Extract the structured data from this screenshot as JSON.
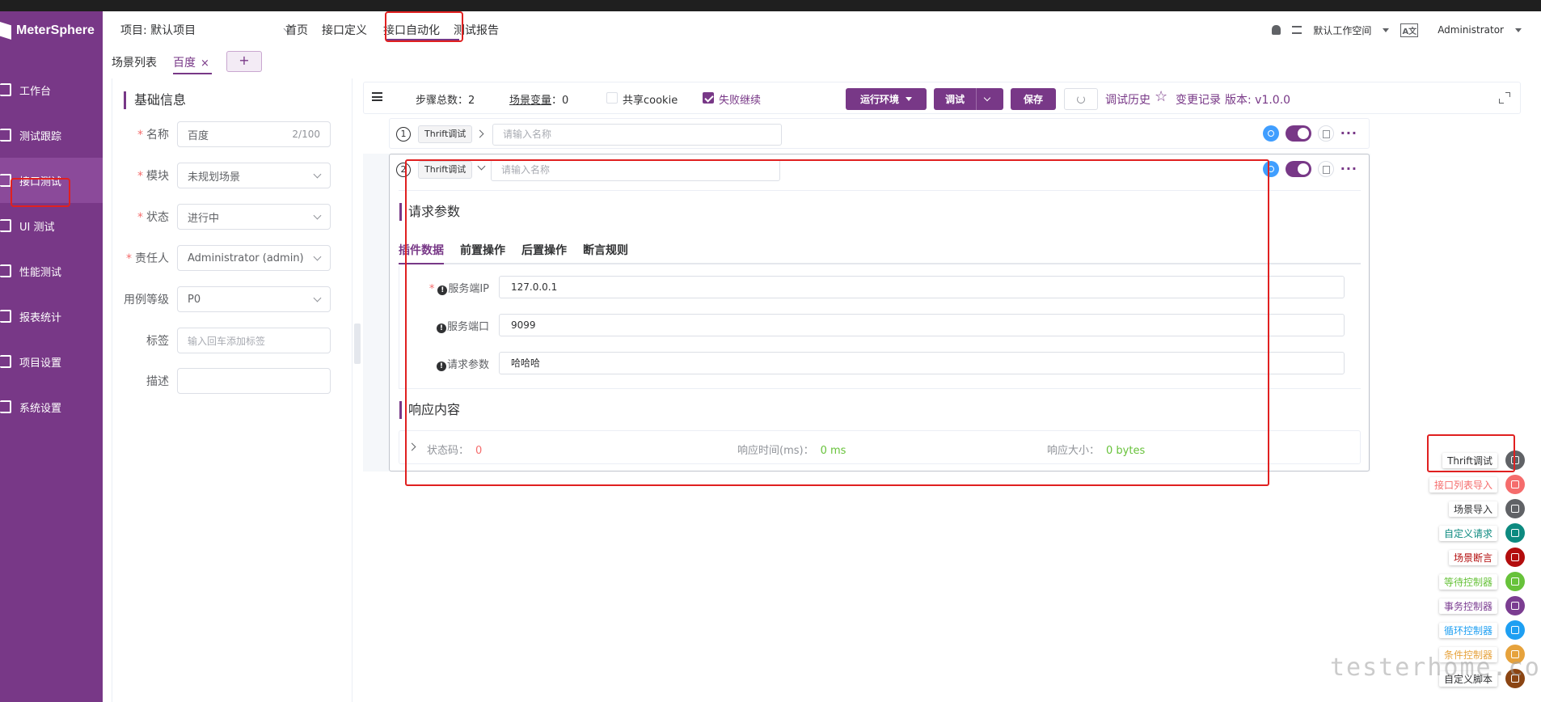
{
  "app": {
    "name": "MeterSphere"
  },
  "sidebar": {
    "items": [
      {
        "label": "工作台",
        "icon": "monitor-icon",
        "active": false
      },
      {
        "label": "测试跟踪",
        "icon": "track-icon",
        "active": false
      },
      {
        "label": "接口测试",
        "icon": "api-icon",
        "active": true
      },
      {
        "label": "UI 测试",
        "icon": "ui-icon",
        "active": false
      },
      {
        "label": "性能测试",
        "icon": "performance-icon",
        "active": false
      },
      {
        "label": "报表统计",
        "icon": "report-icon",
        "active": false
      },
      {
        "label": "项目设置",
        "icon": "project-settings-icon",
        "active": false
      },
      {
        "label": "系统设置",
        "icon": "system-settings-icon",
        "active": false
      }
    ]
  },
  "header": {
    "project": "项目: 默认项目",
    "nav": [
      "首页",
      "接口定义",
      "接口自动化",
      "测试报告"
    ],
    "active_nav": "接口自动化",
    "workspace": "默认工作空间",
    "user": "Administrator"
  },
  "tabs": {
    "list_label": "场景列表",
    "current_tab": "百度",
    "add": "+"
  },
  "base_info": {
    "title": "基础信息",
    "fields": {
      "name_label": "名称",
      "name_value": "百度",
      "name_count": "2/100",
      "module_label": "模块",
      "module_value": "未规划场景",
      "status_label": "状态",
      "status_value": "进行中",
      "owner_label": "责任人",
      "owner_value": "Administrator (admin)",
      "level_label": "用例等级",
      "level_value": "P0",
      "tag_label": "标签",
      "tag_placeholder": "输入回车添加标签",
      "desc_label": "描述"
    }
  },
  "toolbar": {
    "step_total_label": "步骤总数：",
    "step_total": "2",
    "scene_var_label": "场景变量",
    "scene_var_sep": "：",
    "scene_var_count": "0",
    "share_cookie": "共享cookie",
    "fail_continue": "失败继续",
    "run_env": "运行环境",
    "debug": "调试",
    "save": "保存",
    "debug_history": "调试历史",
    "change_log": "变更记录",
    "version": "版本: v1.0.0"
  },
  "steps": [
    {
      "num": "1",
      "tag": "Thrift调试",
      "placeholder": "请输入名称"
    },
    {
      "num": "2",
      "tag": "Thrift调试",
      "placeholder": "请输入名称"
    }
  ],
  "request": {
    "title": "请求参数",
    "tabs": [
      "插件数据",
      "前置操作",
      "后置操作",
      "断言规则"
    ],
    "fields": [
      {
        "label": "服务端IP",
        "value": "127.0.0.1",
        "required": true
      },
      {
        "label": "服务端口",
        "value": "9099",
        "required": false
      },
      {
        "label": "请求参数",
        "value": "哈哈哈",
        "required": false
      }
    ]
  },
  "response": {
    "title": "响应内容",
    "status_label": "状态码：",
    "status_value": "0",
    "time_label": "响应时间(ms)：",
    "time_value": "0 ms",
    "size_label": "响应大小：",
    "size_value": "0 bytes"
  },
  "add_menu": [
    {
      "label": "Thrift调试",
      "color": "#606266",
      "text_color": "#303133",
      "icon": "pencil-icon"
    },
    {
      "label": "接口列表导入",
      "color": "#f56c6c",
      "text_color": "#f56c6c",
      "icon": "import-list-icon"
    },
    {
      "label": "场景导入",
      "color": "#606266",
      "text_color": "#303133",
      "icon": "scene-import-icon"
    },
    {
      "label": "自定义请求",
      "color": "#0d8a80",
      "text_color": "#0d8a80",
      "icon": "custom-request-icon"
    },
    {
      "label": "场景断言",
      "color": "#b30d0d",
      "text_color": "#b30d0d",
      "icon": "assert-icon"
    },
    {
      "label": "等待控制器",
      "color": "#67c23a",
      "text_color": "#67c23a",
      "icon": "clock-icon"
    },
    {
      "label": "事务控制器",
      "color": "#7b3d91",
      "text_color": "#7b3d91",
      "icon": "transaction-icon"
    },
    {
      "label": "循环控制器",
      "color": "#1e9ff2",
      "text_color": "#1e9ff2",
      "icon": "loop-icon"
    },
    {
      "label": "条件控制器",
      "color": "#e6a23c",
      "text_color": "#e6a23c",
      "icon": "condition-icon"
    },
    {
      "label": "自定义脚本",
      "color": "#8b4513",
      "text_color": "#303133",
      "icon": "script-icon"
    }
  ],
  "watermark": "testerhome.com"
}
